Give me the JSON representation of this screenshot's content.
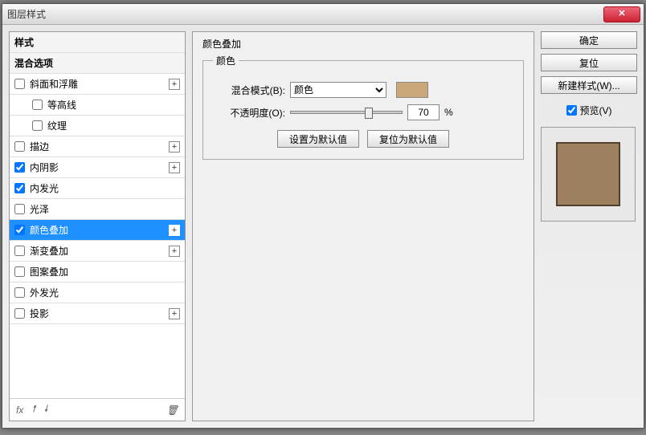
{
  "window": {
    "title": "图层样式"
  },
  "left": {
    "styles_header": "样式",
    "blend_options": "混合选项",
    "items": [
      {
        "label": "斜面和浮雕",
        "checked": false,
        "expandable": true
      },
      {
        "label": "等高线",
        "checked": false,
        "indent": true
      },
      {
        "label": "纹理",
        "checked": false,
        "indent": true
      },
      {
        "label": "描边",
        "checked": false,
        "expandable": true
      },
      {
        "label": "内阴影",
        "checked": true,
        "expandable": true
      },
      {
        "label": "内发光",
        "checked": true
      },
      {
        "label": "光泽",
        "checked": false
      },
      {
        "label": "颜色叠加",
        "checked": true,
        "expandable": true,
        "selected": true
      },
      {
        "label": "渐变叠加",
        "checked": false,
        "expandable": true
      },
      {
        "label": "图案叠加",
        "checked": false
      },
      {
        "label": "外发光",
        "checked": false
      },
      {
        "label": "投影",
        "checked": false,
        "expandable": true
      }
    ],
    "fx": "fx"
  },
  "center": {
    "title": "颜色叠加",
    "fieldset": "颜色",
    "blend_mode_label": "混合模式(B):",
    "blend_mode_value": "颜色",
    "opacity_label": "不透明度(O):",
    "opacity_value": "70",
    "percent": "%",
    "set_default": "设置为默认值",
    "reset_default": "复位为默认值",
    "swatch_color": "#c9a97a"
  },
  "right": {
    "ok": "确定",
    "cancel": "复位",
    "new_style": "新建样式(W)...",
    "preview": "预览(V)"
  }
}
